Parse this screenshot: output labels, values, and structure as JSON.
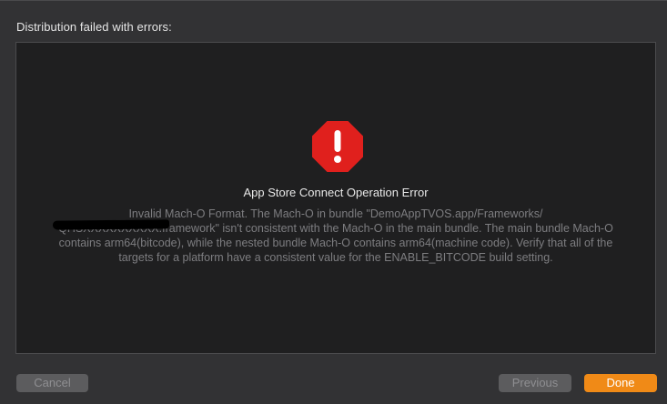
{
  "header": {
    "title": "Distribution failed with errors:"
  },
  "error": {
    "title": "App Store Connect Operation Error",
    "message": "Invalid Mach-O Format. The Mach-O in bundle \"DemoAppTVOS.app/Frameworks/ QHSXXXXXXXXXX.framework\" isn't consistent with the Mach-O in the main bundle. The main bundle Mach-O contains arm64(bitcode), while the nested bundle Mach-O contains arm64(machine code). Verify that all of the targets for a platform have a consistent value for the ENABLE_BITCODE build setting.",
    "icon": "alert-octagon-icon",
    "icon_color": "#e0201d"
  },
  "buttons": {
    "cancel": "Cancel",
    "previous": "Previous",
    "done": "Done",
    "accent_color": "#f08a17"
  }
}
